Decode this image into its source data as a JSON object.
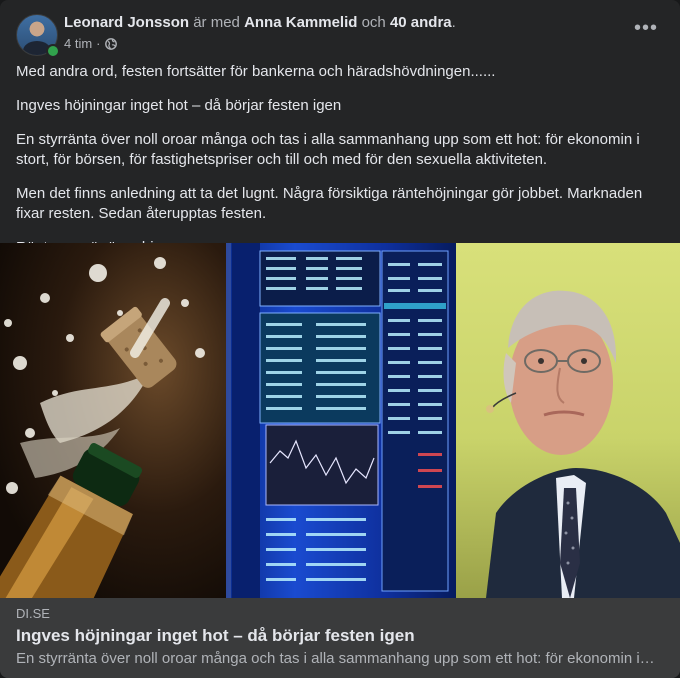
{
  "post": {
    "author": "Leonard Jonsson",
    "with_text": "är med",
    "tagged": "Anna Kammelid",
    "and_text": "och",
    "others": "40 andra",
    "period": ".",
    "time": "4 tim",
    "separator": "·",
    "privacy_icon": "globe-icon",
    "more_icon": "more-options-icon",
    "more_label": "•••",
    "paragraphs": [
      "Med andra ord, festen fortsätter för bankerna och häradshövdningen......",
      "Ingves höjningar inget hot – då börjar festen igen",
      "En styrränta över noll oroar många och tas i alla sammanhang upp som ett hot: för ekonomin i stort, för börsen, för fastighetspriser och till och med för den sexuella aktiviteten.",
      "Men det finns anledning att ta det lugnt. Några försiktiga räntehöjningar gör jobbet. Marknaden fixar resten. Sedan återupptas festen.",
      "Ränteoron är överdriven."
    ]
  },
  "link": {
    "domain": "DI.SE",
    "title": "Ingves höjningar inget hot – då börjar festen igen",
    "description": "En styrränta över noll oroar många och tas i alla sammanhang upp som ett hot: för ekonomin i stort, för börsen, för fastighetspriser och till och med för den sexuella aktiviteten."
  },
  "colors": {
    "card_bg": "#242526",
    "text_primary": "#e4e6eb",
    "text_secondary": "#b0b3b8",
    "preview_bg": "#3a3b3c",
    "online": "#31a24c"
  }
}
